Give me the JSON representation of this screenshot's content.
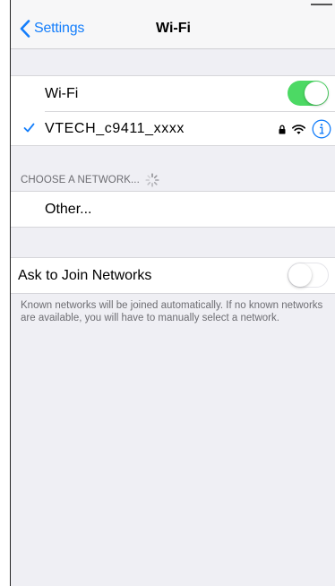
{
  "navbar": {
    "back_label": "Settings",
    "title": "Wi-Fi"
  },
  "wifi": {
    "label": "Wi-Fi",
    "enabled": true
  },
  "connected_network": {
    "name": "VTECH_c9411_xxxx",
    "secured": true,
    "icons": [
      "checkmark-icon",
      "lock-icon",
      "wifi-signal-icon",
      "info-icon"
    ]
  },
  "choose_network": {
    "header": "CHOOSE A NETWORK...",
    "other_label": "Other..."
  },
  "ask_to_join": {
    "label": "Ask to Join Networks",
    "enabled": false,
    "footer": "Known networks will be joined automatically. If no known networks are available, you will have to manually select a network."
  },
  "colors": {
    "accent": "#147efb",
    "toggle_on": "#4cd964",
    "background": "#efeff4"
  }
}
